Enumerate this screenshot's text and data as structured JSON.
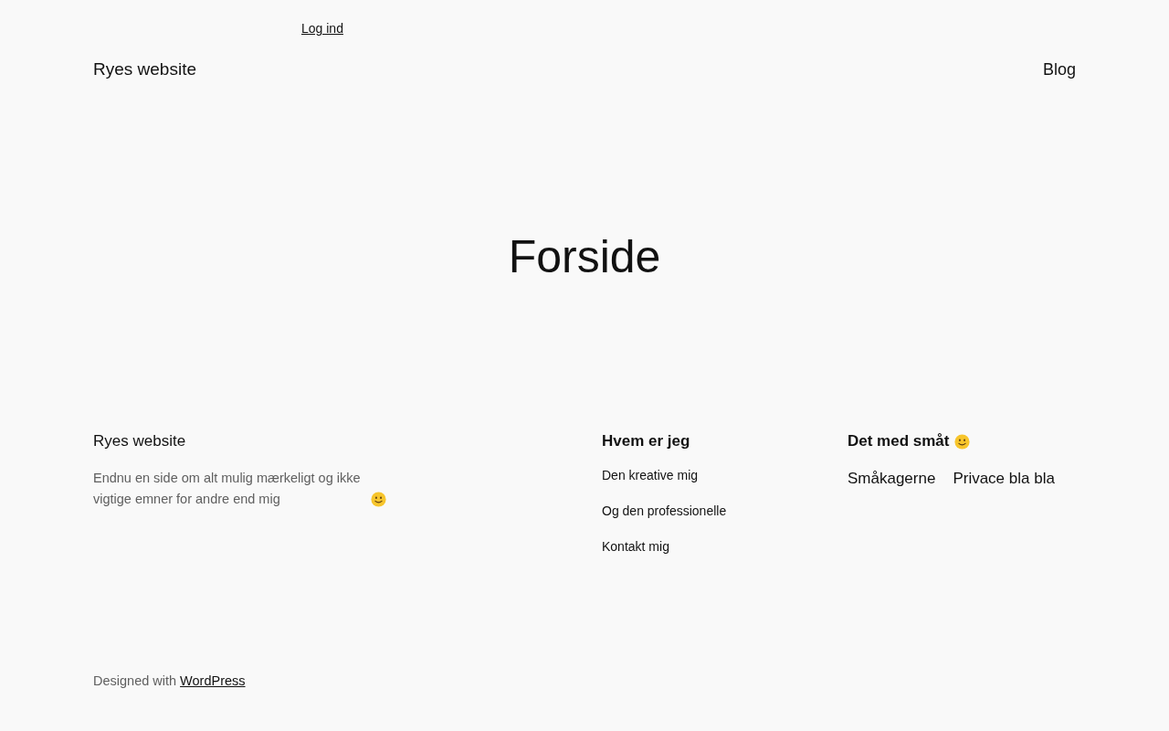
{
  "header": {
    "login_link": "Log ind",
    "site_title": "Ryes website",
    "nav": [
      {
        "label": "Blog"
      }
    ]
  },
  "page_title": "Forside",
  "footer": {
    "site_title": "Ryes website",
    "description": {
      "text": "Endnu en side om alt mulig mærkeligt og ikke vigtige emner for andre end mig",
      "trailing_icon": true
    },
    "columns": [
      {
        "heading": "Hvem er jeg",
        "trailing_icon": false,
        "kind": "list",
        "links": [
          "Den kreative mig",
          "Og den professionelle",
          "Kontakt mig"
        ]
      },
      {
        "heading": "Det med småt",
        "trailing_icon": true,
        "kind": "row",
        "links": [
          "Småkagerne",
          "Privace bla bla"
        ]
      }
    ],
    "credit": {
      "text": "Designed with",
      "link": "WordPress"
    }
  }
}
